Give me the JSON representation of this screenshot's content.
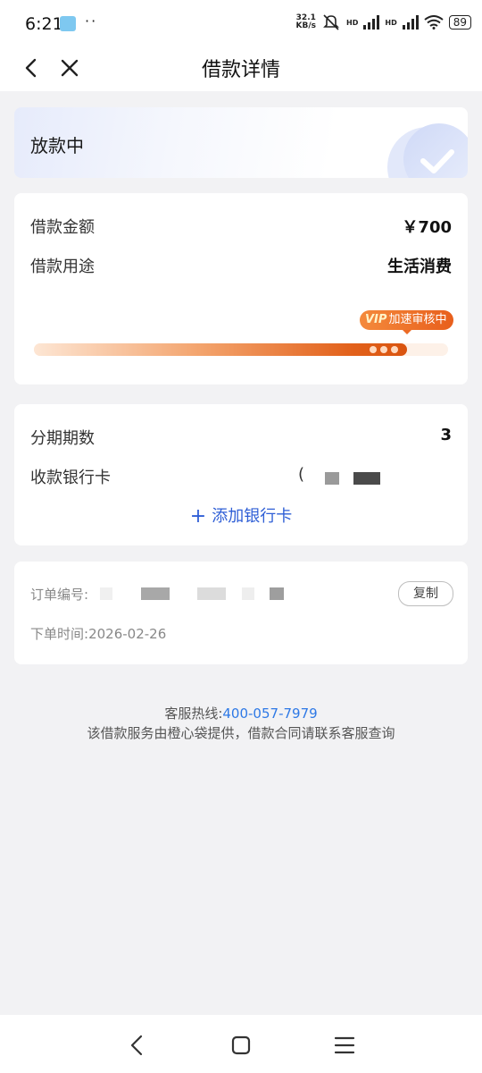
{
  "status_bar": {
    "time": "6:21",
    "dots": "··",
    "net_speed_value": "32.1",
    "net_speed_unit": "KB/s",
    "hd1": "HD",
    "hd2": "HD",
    "battery": "89",
    "icons": [
      "gallery-app-icon",
      "mute-icon",
      "signal-icon",
      "signal-icon",
      "wifi-icon",
      "battery-icon"
    ]
  },
  "nav": {
    "title": "借款详情",
    "back_icon": "chevron-left-icon",
    "close_icon": "close-icon"
  },
  "status_card": {
    "status": "放款中",
    "icon": "check-circle-icon"
  },
  "loan": {
    "amount_label": "借款金额",
    "amount_value": "￥700",
    "purpose_label": "借款用途",
    "purpose_value": "生活消费",
    "vip_prefix": "VIP",
    "vip_text": "加速审核中",
    "progress": 0.9
  },
  "installment": {
    "periods_label": "分期期数",
    "periods_value": "3",
    "bank_label": "收款银行卡",
    "bank_value_prefix": "(",
    "add_bank": "添加银行卡"
  },
  "order": {
    "order_no_label": "订单编号:",
    "copy_button": "复制",
    "time_label": "下单时间:",
    "time_value": "2026-02-26"
  },
  "footer": {
    "hotline_label": "客服热线:",
    "hotline_number": "400-057-7979",
    "disclaimer": "该借款服务由橙心袋提供，借款合同请联系客服查询"
  },
  "colors": {
    "accent_blue": "#2f5fd6",
    "phone_blue": "#2e79e6",
    "vip_orange": "#e85f1c"
  }
}
